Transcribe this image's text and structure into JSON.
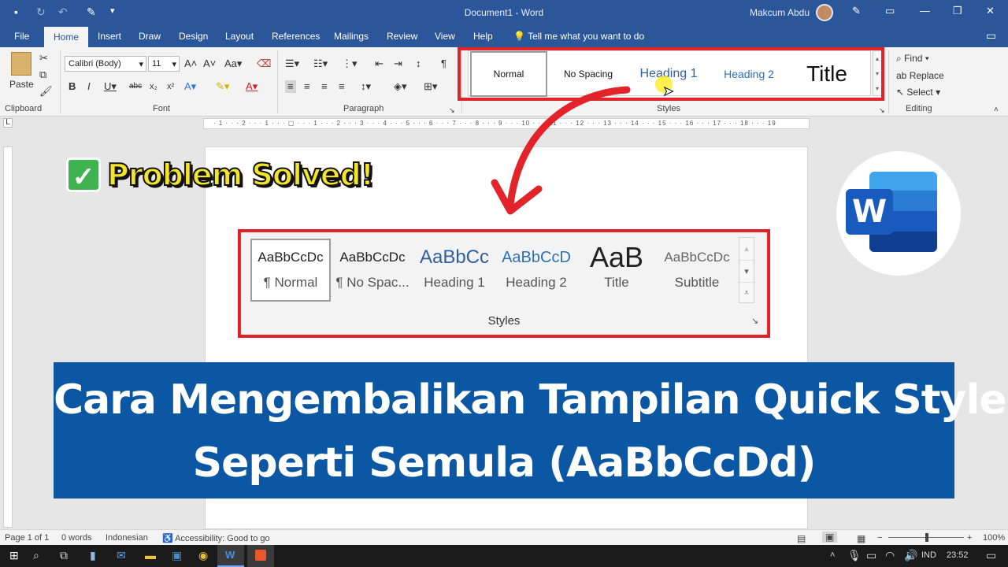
{
  "titlebar": {
    "doc_title": "Document1  -  Word",
    "user": "Makcum Abdu"
  },
  "tabs": [
    "File",
    "Home",
    "Insert",
    "Draw",
    "Design",
    "Layout",
    "References",
    "Mailings",
    "Review",
    "View",
    "Help"
  ],
  "tell_me": "Tell me what you want to do",
  "ribbon": {
    "clipboard": {
      "paste": "Paste",
      "label": "Clipboard"
    },
    "font": {
      "name": "Calibri (Body)",
      "size": "11",
      "label": "Font"
    },
    "paragraph": {
      "label": "Paragraph"
    },
    "styles": {
      "label": "Styles",
      "items": [
        "Normal",
        "No Spacing",
        "Heading 1",
        "Heading 2",
        "Title"
      ]
    },
    "editing": {
      "find": "Find",
      "replace": "Replace",
      "select": "Select",
      "label": "Editing"
    }
  },
  "ruler": "· 1 · · · 2 · · · 1 · · · ▢ · · · 1 · · · 2 · · · 3 · · · 4 · · · 5 · · · 6 · · · 7 · · · 8 · · · 9 · · · 10 · · · 11 · · · 12 · · · 13 · · · 14 · · · 15 · · · 16 · · · 17 · · · 18 · · · 19",
  "overlay": {
    "problem_solved": "Problem Solved!",
    "check": "✓"
  },
  "gallery": {
    "items": [
      {
        "preview": "AaBbCcDc",
        "label": "¶ Normal"
      },
      {
        "preview": "AaBbCcDc",
        "label": "¶ No Spac..."
      },
      {
        "preview": "AaBbCc",
        "label": "Heading 1"
      },
      {
        "preview": "AaBbCcD",
        "label": "Heading 2"
      },
      {
        "preview": "AaB",
        "label": "Title"
      },
      {
        "preview": "AaBbCcDc",
        "label": "Subtitle"
      }
    ],
    "label": "Styles"
  },
  "banner": {
    "line1": "Cara Mengembalikan Tampilan Quick Style",
    "line2": "Seperti Semula (AaBbCcDd)"
  },
  "status": {
    "page": "Page 1 of 1",
    "words": "0 words",
    "language": "Indonesian",
    "accessibility": "Accessibility: Good to go",
    "zoom": "100%"
  },
  "taskbar": {
    "lang": "IND",
    "time": "23:52"
  },
  "colors": {
    "word_blue": "#2b579a",
    "highlight_red": "#e3232a",
    "banner": "#0b57a3"
  }
}
